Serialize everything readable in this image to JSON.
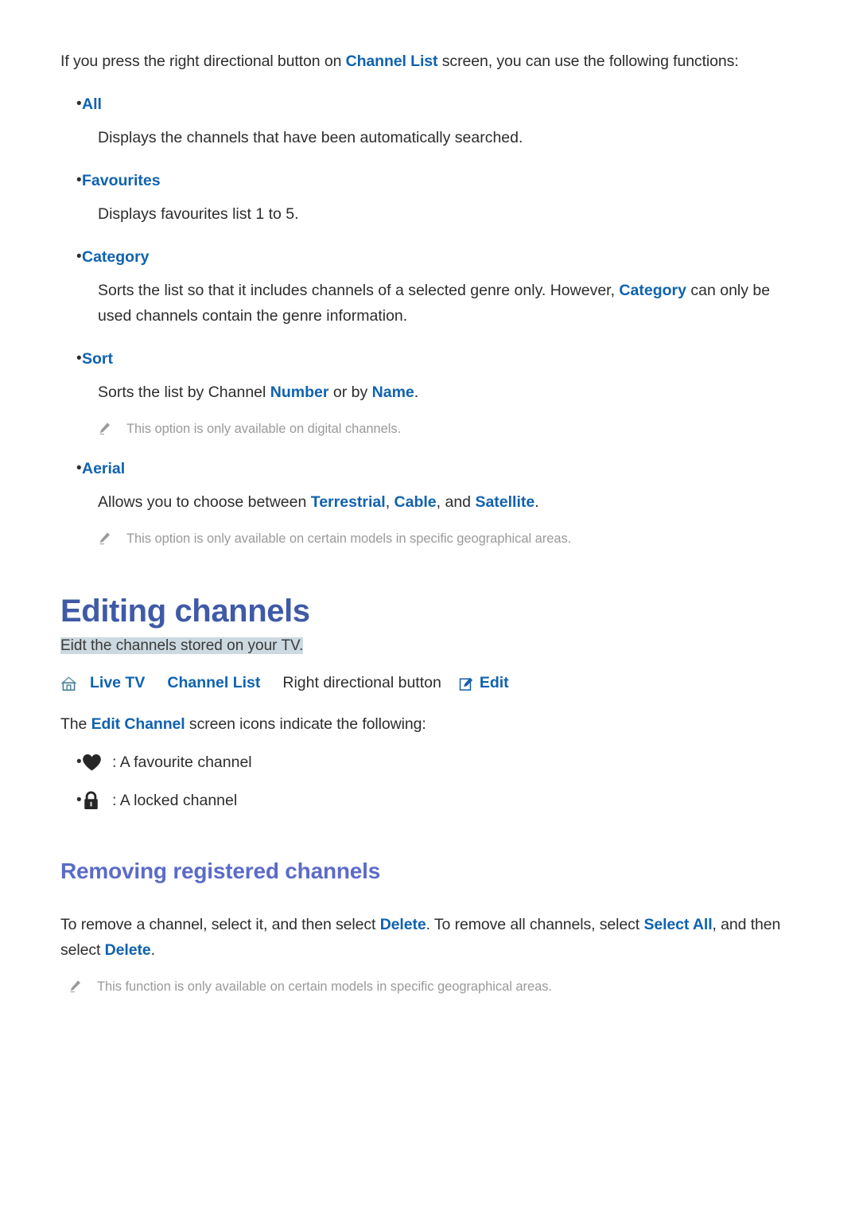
{
  "intro": {
    "prefix": "If you press the right directional button on ",
    "link": "Channel List",
    "suffix": " screen, you can use the following functions:"
  },
  "options": [
    {
      "term": "All",
      "body": "Displays the channels that have been automatically searched."
    },
    {
      "term": "Favourites",
      "body": "Displays favourites list 1 to 5."
    },
    {
      "term": "Category",
      "body_1": "Sorts the list so that it includes channels of a selected genre only. However, ",
      "body_link": "Category",
      "body_2": " can only be used channels contain the genre information."
    },
    {
      "term": "Sort",
      "body_1": "Sorts the list by Channel ",
      "body_link_1": "Number",
      "body_2": " or by ",
      "body_link_2": "Name",
      "body_3": ".",
      "note": "This option is only available on digital channels."
    },
    {
      "term": "Aerial",
      "body_1": "Allows you to choose between ",
      "body_link_1": "Terrestrial",
      "body_2": ", ",
      "body_link_2": "Cable",
      "body_3": ", and ",
      "body_link_3": "Satellite",
      "body_4": ".",
      "note": "This option is only available on certain models in specific geographical areas."
    }
  ],
  "editing_section": {
    "title": "Editing channels",
    "subtitle_highlighted": "Eidt the channels stored on your TV.",
    "nav": {
      "home_icon": "home-icon",
      "item_1": "Live TV",
      "item_2": "Channel List",
      "plain": "Right directional button",
      "edit_icon": "edit-pencil-icon",
      "edit_label": "Edit"
    },
    "icons_intro_prefix": "The ",
    "icons_intro_link": "Edit Channel",
    "icons_intro_suffix": " screen icons indicate the following:",
    "icon_items": [
      {
        "icon": "heart-icon",
        "text": ": A favourite channel"
      },
      {
        "icon": "lock-icon",
        "text": ": A locked channel"
      }
    ]
  },
  "removing_section": {
    "title": "Removing registered channels",
    "body_1": "To remove a channel, select it, and then select ",
    "body_link_1": "Delete",
    "body_2": ". To remove all channels, select ",
    "body_link_2": "Select All",
    "body_3": ", and then select ",
    "body_link_3": "Delete",
    "body_4": ".",
    "note": "This function is only available on certain models in specific geographical areas."
  },
  "colors": {
    "link": "#0f62b0",
    "h1": "#3f5aa6",
    "h2": "#5b6bc8",
    "note_text": "#9a9a9a",
    "highlight_bg": "#ccd9e0",
    "body_text": "#2d2d2d"
  }
}
